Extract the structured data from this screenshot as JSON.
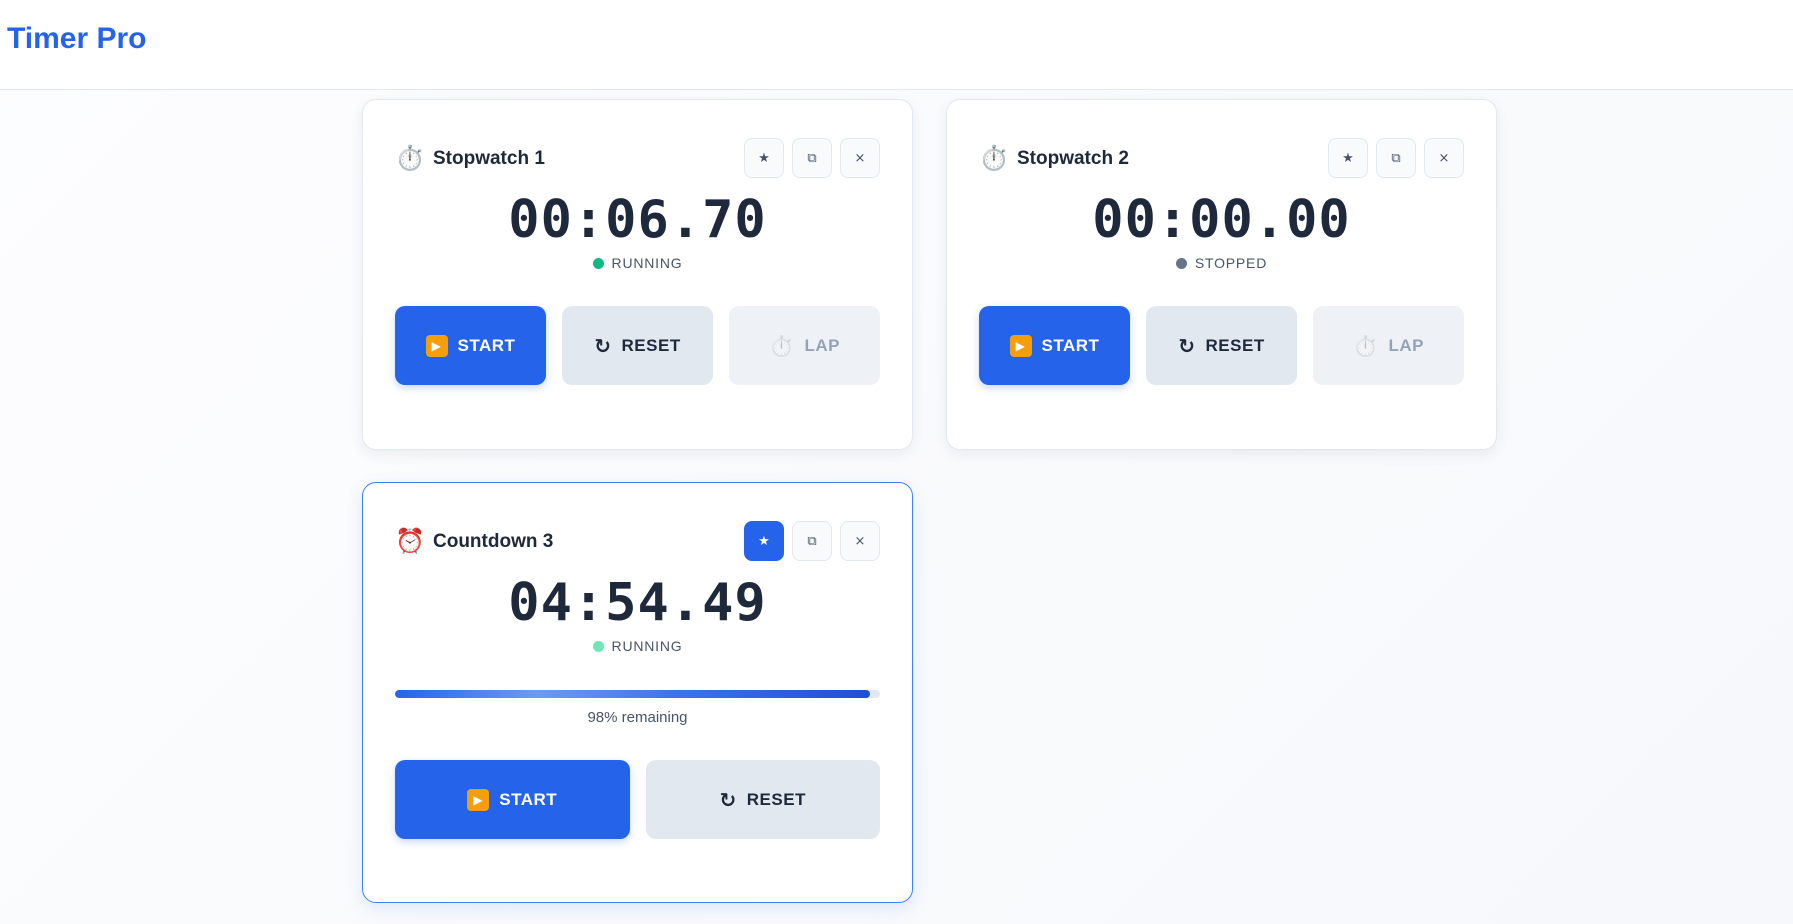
{
  "app": {
    "title": "Timer Pro"
  },
  "colors": {
    "accent": "#2563eb",
    "running_dot": "#10b981",
    "running_dot_countdown": "#6ee7b7",
    "stopped_dot": "#64748b",
    "start_icon_bg": "#f59e0b"
  },
  "timers": [
    {
      "icon": "stopwatch-icon",
      "icon_glyph": "⏱️",
      "name": "Stopwatch 1",
      "time": "00:06.70",
      "status": "RUNNING",
      "starred": false,
      "star_glyph": "★",
      "duplicate_glyph": "⧉",
      "close_glyph": "×",
      "buttons": {
        "start_glyph": "▶",
        "start": "START",
        "reset_glyph": "↻",
        "reset": "RESET",
        "lap_glyph": "⏱️",
        "lap": "LAP"
      }
    },
    {
      "icon": "stopwatch-icon",
      "icon_glyph": "⏱️",
      "name": "Stopwatch 2",
      "time": "00:00.00",
      "status": "STOPPED",
      "starred": false,
      "star_glyph": "★",
      "duplicate_glyph": "⧉",
      "close_glyph": "×",
      "buttons": {
        "start_glyph": "▶",
        "start": "START",
        "reset_glyph": "↻",
        "reset": "RESET",
        "lap_glyph": "⏱️",
        "lap": "LAP"
      }
    },
    {
      "icon": "alarm-clock-icon",
      "icon_glyph": "⏰",
      "name": "Countdown 3",
      "time": "04:54.49",
      "status": "RUNNING",
      "starred": true,
      "star_glyph": "★",
      "duplicate_glyph": "⧉",
      "close_glyph": "×",
      "progress_percent": 98,
      "progress_label": "98% remaining",
      "buttons": {
        "start_glyph": "▶",
        "start": "START",
        "reset_glyph": "↻",
        "reset": "RESET"
      }
    }
  ]
}
